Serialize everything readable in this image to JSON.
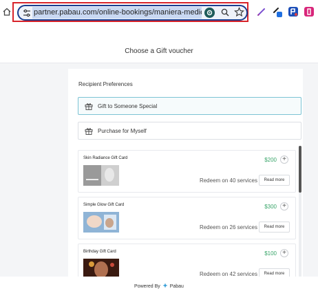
{
  "browser": {
    "url": "partner.pabau.com/online-bookings/maniera-medical?group"
  },
  "page": {
    "title": "Choose a Gift voucher",
    "section_title": "Recipient Preferences"
  },
  "options": [
    {
      "label": "Gift to Someone Special",
      "selected": true
    },
    {
      "label": "Purchase for Myself",
      "selected": false
    }
  ],
  "cards": [
    {
      "name": "Skin Radiance Gift Card",
      "price": "$200",
      "redeem": "Redeem on 40 services",
      "read_more": "Read more",
      "add": "+"
    },
    {
      "name": "Simple Glow Gift Card",
      "price": "$300",
      "redeem": "Redeem on 26 services",
      "read_more": "Read more",
      "add": "+"
    },
    {
      "name": "Birthday Gift Card",
      "price": "$100",
      "redeem": "Redeem on 42 services",
      "read_more": "Read more",
      "add": "+"
    }
  ],
  "footer": {
    "powered_by": "Powered By",
    "brand": "Pabau"
  },
  "colors": {
    "accent_border": "#7cc3d4",
    "price_green": "#39a56a",
    "annotation_red": "#d8232a"
  }
}
